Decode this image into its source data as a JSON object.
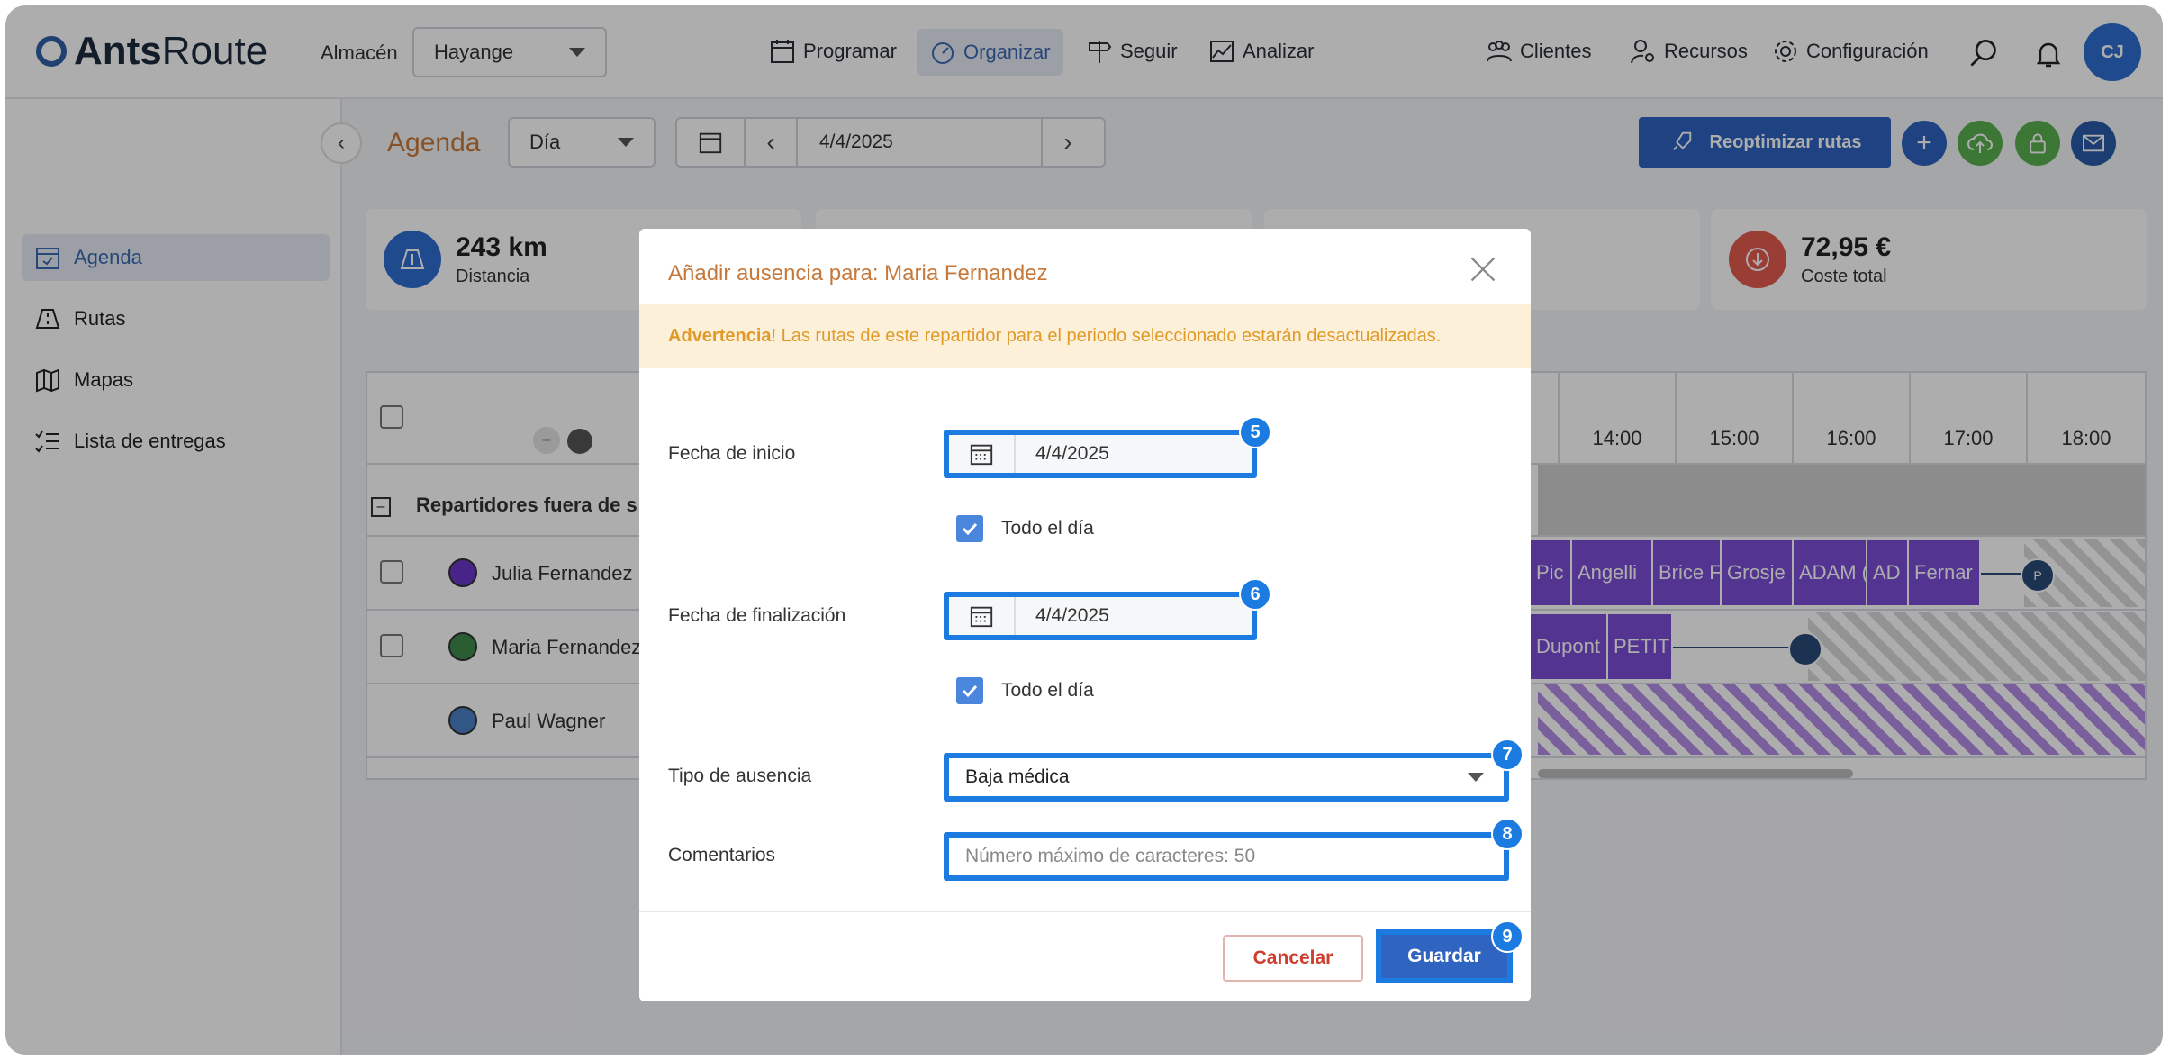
{
  "brand": {
    "name_bold": "Ants",
    "name_regular": "Route"
  },
  "topbar": {
    "warehouse_label": "Almacén",
    "warehouse_value": "Hayange",
    "nav": [
      {
        "label": "Programar",
        "icon": "calendar-grid-icon"
      },
      {
        "label": "Organizar",
        "icon": "gauge-icon",
        "active": true
      },
      {
        "label": "Seguir",
        "icon": "signpost-icon"
      },
      {
        "label": "Analizar",
        "icon": "chart-icon"
      }
    ],
    "right_nav": [
      {
        "label": "Clientes",
        "icon": "people-icon"
      },
      {
        "label": "Recursos",
        "icon": "user-gear-icon"
      },
      {
        "label": "Configuración",
        "icon": "gear-icon"
      }
    ],
    "avatar_initials": "CJ"
  },
  "sidebar": {
    "items": [
      {
        "label": "Agenda",
        "icon": "calendar-check-icon",
        "active": true
      },
      {
        "label": "Rutas",
        "icon": "road-icon"
      },
      {
        "label": "Mapas",
        "icon": "map-icon"
      },
      {
        "label": "Lista de entregas",
        "icon": "checklist-icon"
      }
    ]
  },
  "toolbar": {
    "title": "Agenda",
    "view_select": "Día",
    "date": "4/4/2025",
    "reoptimize_label": "Reoptimizar rutas"
  },
  "stats": {
    "distance_value": "243 km",
    "distance_label": "Distancia",
    "cost_value": "72,95 €",
    "cost_label": "Coste total"
  },
  "grid": {
    "hours": [
      "14:00",
      "15:00",
      "16:00",
      "17:00",
      "18:00"
    ],
    "group_label": "Repartidores fuera de s",
    "drivers": [
      {
        "name": "Julia Fernandez",
        "color": "#6a35c9"
      },
      {
        "name": "Maria Fernandez",
        "color": "#3f8a4a"
      },
      {
        "name": "Paul Wagner",
        "color": "#4a7fc4"
      }
    ],
    "row1_tasks": [
      "Pic",
      "Angelli",
      "Brice F",
      "Grosje",
      "ADAM (",
      "AD",
      "Fernar"
    ],
    "row2_tasks": [
      "Dupont",
      "PETIT"
    ]
  },
  "modal": {
    "title": "Añadir ausencia para: Maria Fernandez",
    "warning_strong": "Advertencia",
    "warning_text": " ! Las rutas de este repartidor para el periodo seleccionado estarán desactualizadas.",
    "start_label": "Fecha de inicio",
    "start_value": "4/4/2025",
    "start_allday": "Todo el día",
    "end_label": "Fecha de finalización",
    "end_value": "4/4/2025",
    "end_allday": "Todo el día",
    "type_label": "Tipo de ausencia",
    "type_value": "Baja médica",
    "comments_label": "Comentarios",
    "comments_placeholder": "Número máximo de caracteres: 50",
    "cancel_label": "Cancelar",
    "save_label": "Guardar",
    "badges": [
      "5",
      "6",
      "7",
      "8",
      "9"
    ]
  },
  "colors": {
    "accent": "#1b7be0",
    "primary": "#2f64c0",
    "warning": "#e09a2a",
    "title_orange": "#c7793b",
    "task_purple": "#7b4fd6"
  }
}
